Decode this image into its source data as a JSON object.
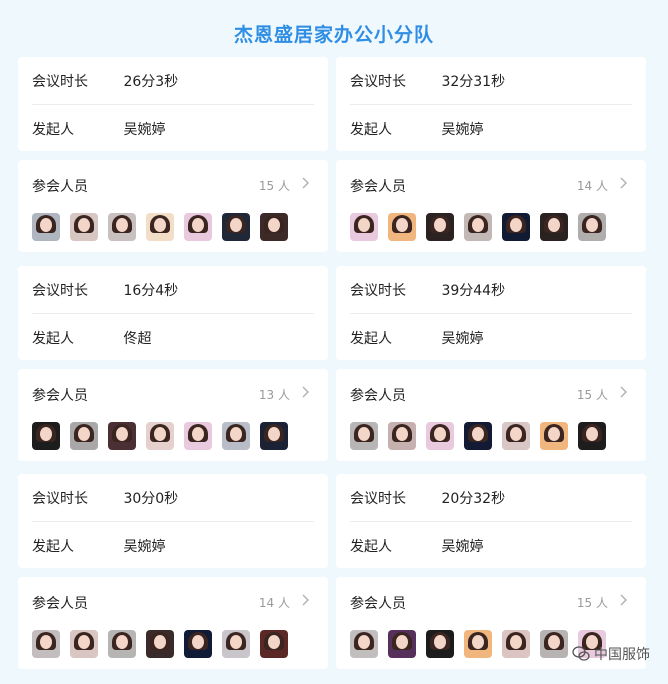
{
  "title": "杰恩盛居家办公小分队",
  "labels": {
    "duration": "会议时长",
    "initiator": "发起人",
    "attendees": "参会人员"
  },
  "meetings": [
    {
      "duration": "26分3秒",
      "initiator": "吴婉婷",
      "count": "15 人",
      "avatars": [
        "#b0b6bf",
        "#d8c6c3",
        "#c9c1bf",
        "#f2ddc7",
        "#e8c9dd",
        "#202838",
        "#3b2a27"
      ]
    },
    {
      "duration": "32分31秒",
      "initiator": "吴婉婷",
      "count": "14 人",
      "avatars": [
        "#e8c9dd",
        "#f0b67d",
        "#2b2222",
        "#c2b8b6",
        "#111b34",
        "#2a2121",
        "#b0aead"
      ]
    },
    {
      "duration": "16分4秒",
      "initiator": "佟超",
      "count": "13 人",
      "avatars": [
        "#1d1d1d",
        "#a9a7a7",
        "#4a3035",
        "#e6d0cd",
        "#e8c9dd",
        "#b8bdc8",
        "#1b2235"
      ]
    },
    {
      "duration": "39分44秒",
      "initiator": "吴婉婷",
      "count": "15 人",
      "avatars": [
        "#b8b5b6",
        "#c6b1b0",
        "#e8c9dd",
        "#131a33",
        "#d9c7c6",
        "#f0b67d",
        "#1d1d1d"
      ]
    },
    {
      "duration": "30分0秒",
      "initiator": "吴婉婷",
      "count": "14 人",
      "avatars": [
        "#c3bdbd",
        "#d9c6c3",
        "#b7b5b3",
        "#3a2a2a",
        "#101b36",
        "#c9c5ca",
        "#5b2826"
      ]
    },
    {
      "duration": "20分32秒",
      "initiator": "吴婉婷",
      "count": "15 人",
      "avatars": [
        "#c1bebd",
        "#54305a",
        "#1c1c1c",
        "#f0b67d",
        "#dbc4c1",
        "#b7b3b3",
        "#e8c9dd"
      ]
    }
  ],
  "watermark": "中国服饰"
}
